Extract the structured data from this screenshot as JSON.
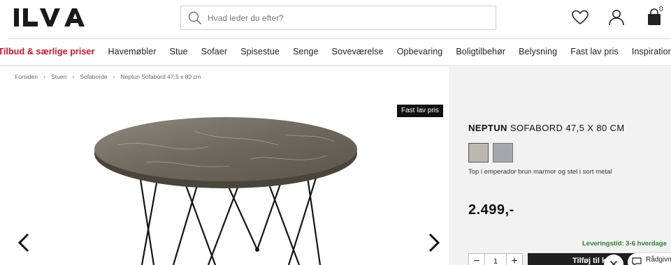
{
  "header": {
    "logo_text": "ILVA",
    "search_placeholder": "Hvad leder du efter?",
    "cart_count": "0"
  },
  "nav": {
    "items": [
      "Tilbud & særlige priser",
      "Havemøbler",
      "Stue",
      "Sofaer",
      "Spisestue",
      "Senge",
      "Soveværelse",
      "Opbevaring",
      "Boligtilbehør",
      "Belysning",
      "Fast lav pris",
      "Inspiration"
    ]
  },
  "breadcrumb": [
    "Forsiden",
    "Stuen",
    "Sofaborde",
    "Neptun Sofabord 47,5 x 80 cm"
  ],
  "gallery": {
    "badge": "Fast lav pris"
  },
  "product": {
    "name": "NEPTUN",
    "subtitle": "SOFABORD 47,5 X 80 CM",
    "swatch_colors": [
      "#bcb7b1",
      "#a4a8ac"
    ],
    "description": "Top i emperador brun marmor og stel i sort metal",
    "price": "2.499,-",
    "delivery": "Leveringstid: 3-6 hverdage",
    "quantity": "1",
    "add_to_cart_label": "Tilføj til kurv",
    "qty_minus": "−",
    "qty_plus": "+"
  },
  "chat": {
    "label": "Rådgivning"
  },
  "colors": {
    "sale_red": "#c8102e",
    "delivery_green": "#2e7d32",
    "panel_bg": "#f2f2f2"
  }
}
